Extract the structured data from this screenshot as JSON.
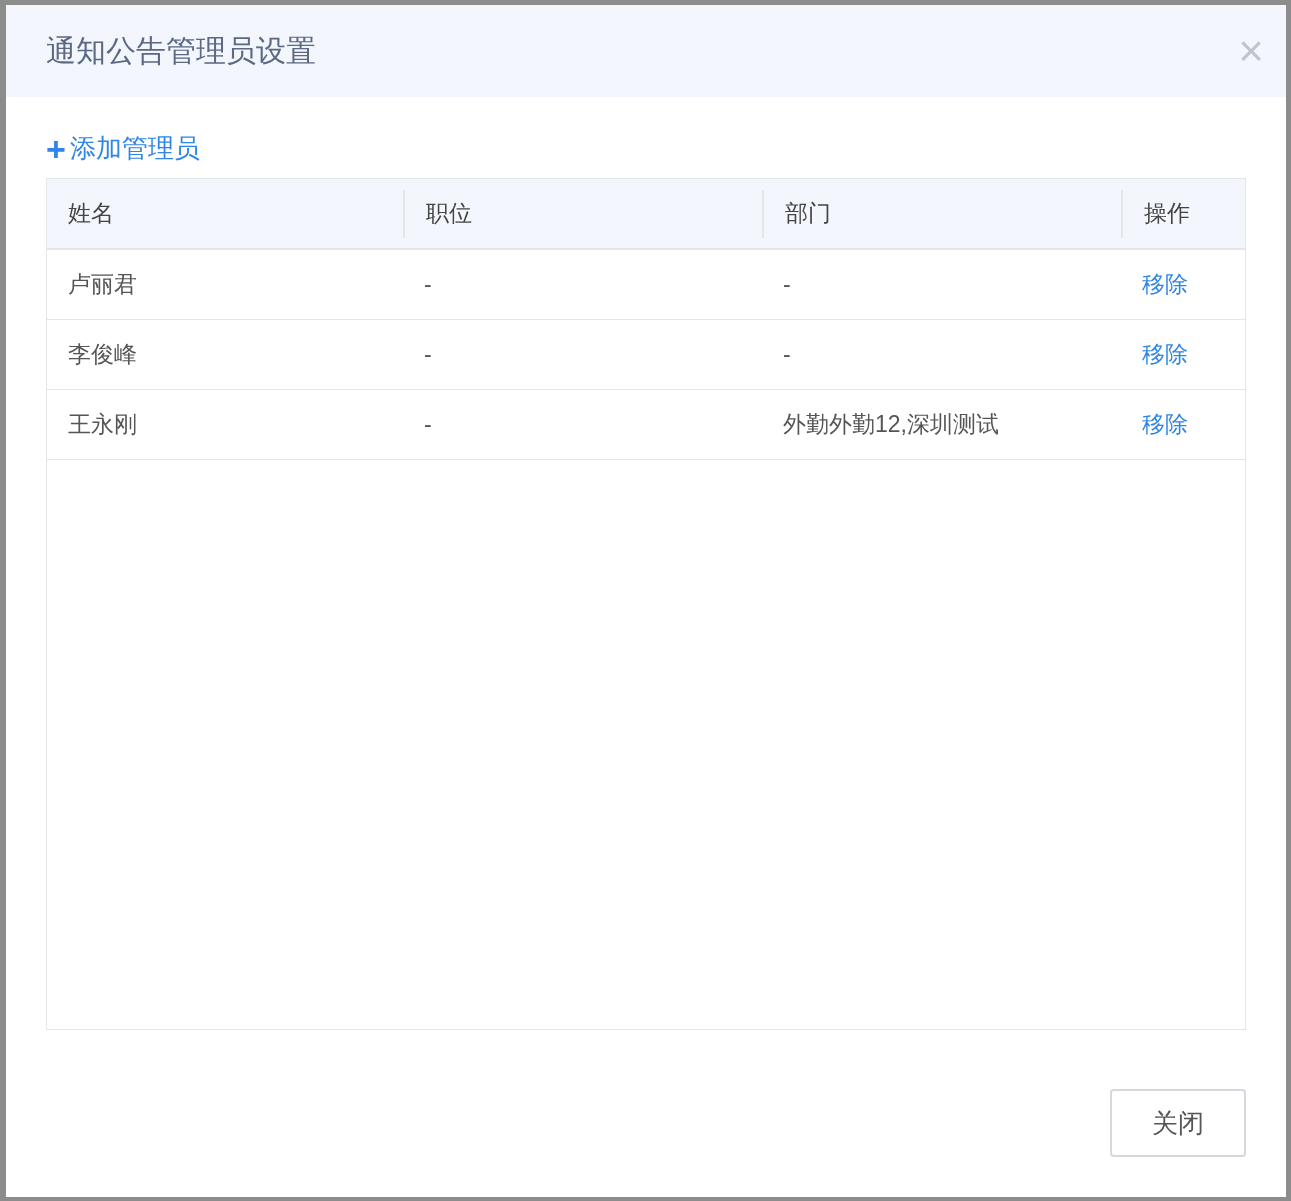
{
  "dialog": {
    "title": "通知公告管理员设置",
    "close_icon": "×"
  },
  "add_link": {
    "icon": "+",
    "label": "添加管理员"
  },
  "table": {
    "columns": [
      "姓名",
      "职位",
      "部门",
      "操作"
    ],
    "rows": [
      {
        "name": "卢丽君",
        "position": "-",
        "department": "-",
        "action": "移除"
      },
      {
        "name": "李俊峰",
        "position": "-",
        "department": "-",
        "action": "移除"
      },
      {
        "name": "王永刚",
        "position": "-",
        "department": "外勤外勤12,深圳测试",
        "action": "移除"
      }
    ]
  },
  "footer": {
    "close_button": "关闭"
  }
}
